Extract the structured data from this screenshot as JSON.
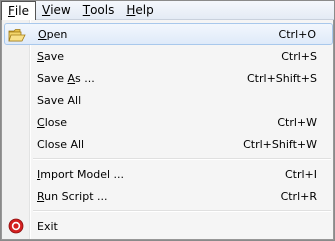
{
  "menubar": {
    "items": [
      {
        "label": "File",
        "access_key": "F",
        "active": true
      },
      {
        "label": "View",
        "access_key": "V"
      },
      {
        "label": "Tools",
        "access_key": "T"
      },
      {
        "label": "Help",
        "access_key": "H"
      }
    ]
  },
  "file_menu": {
    "items": [
      {
        "label": "Open",
        "access_key": "O",
        "shortcut": "Ctrl+O",
        "icon": "folder-open-icon",
        "highlighted": true
      },
      {
        "label": "Save",
        "access_key": "S",
        "shortcut": "Ctrl+S"
      },
      {
        "label": "Save As ...",
        "access_key": "A",
        "shortcut": "Ctrl+Shift+S"
      },
      {
        "label": "Save All",
        "shortcut": ""
      },
      {
        "label": "Close",
        "access_key": "C",
        "shortcut": "Ctrl+W"
      },
      {
        "label": "Close All",
        "shortcut": "Ctrl+Shift+W"
      },
      {
        "label": "Import Model ...",
        "access_key": "I",
        "shortcut": "Ctrl+I"
      },
      {
        "label": "Run Script ...",
        "access_key": "R",
        "shortcut": "Ctrl+R"
      },
      {
        "label": "Exit",
        "shortcut": "",
        "icon": "exit-icon"
      }
    ]
  },
  "colors": {
    "highlight_border": "#a8c8ec",
    "menubar_background": "#e4ebf5",
    "exit_icon_red": "#d42020"
  }
}
